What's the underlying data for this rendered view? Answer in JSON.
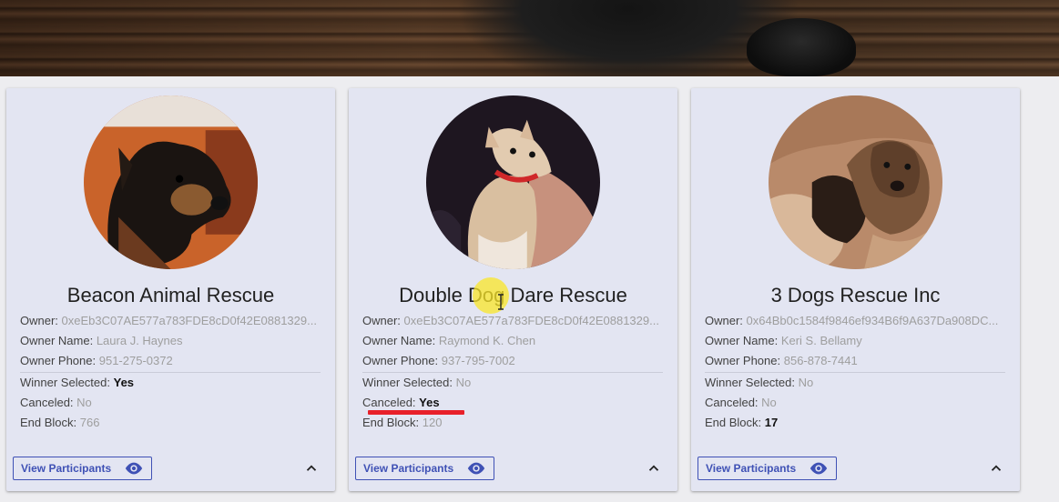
{
  "cards": [
    {
      "name": "Beacon Animal Rescue",
      "owner_label": "Owner:",
      "owner": "0xeEb3C07AE577a783FDE8cD0f42E0881329...",
      "owner_name_label": "Owner Name:",
      "owner_name": "Laura J. Haynes",
      "owner_phone_label": "Owner Phone:",
      "owner_phone": "951-275-0372",
      "winner_label": "Winner Selected:",
      "winner": "Yes",
      "canceled_label": "Canceled:",
      "canceled": "No",
      "end_block_label": "End Block:",
      "end_block": "766",
      "button_label": "View Participants",
      "image": "dog-portrait-black-tan"
    },
    {
      "name": "Double Dog Dare Rescue",
      "owner_label": "Owner:",
      "owner": "0xeEb3C07AE577a783FDE8cD0f42E0881329...",
      "owner_name_label": "Owner Name:",
      "owner_name": "Raymond K. Chen",
      "owner_phone_label": "Owner Phone:",
      "owner_phone": "937-795-7002",
      "winner_label": "Winner Selected:",
      "winner": "No",
      "canceled_label": "Canceled:",
      "canceled": "Yes",
      "end_block_label": "End Block:",
      "end_block": "120",
      "button_label": "View Participants",
      "image": "chihuahua-red-collar"
    },
    {
      "name": "3 Dogs Rescue Inc",
      "owner_label": "Owner:",
      "owner": "0x64Bb0c1584f9846ef934B6f9A637Da908DC...",
      "owner_name_label": "Owner Name:",
      "owner_name": "Keri S. Bellamy",
      "owner_phone_label": "Owner Phone:",
      "owner_phone": "856-878-7441",
      "winner_label": "Winner Selected:",
      "winner": "No",
      "canceled_label": "Canceled:",
      "canceled": "No",
      "end_block_label": "End Block:",
      "end_block": "17",
      "button_label": "View Participants",
      "image": "brindle-dog-with-puppies"
    }
  ],
  "icons": {
    "view": "eye-icon",
    "collapse": "chevron-up-icon"
  },
  "colors": {
    "accent": "#3f51b5",
    "card_bg": "#e3e5f2",
    "annotation": "#e8202a",
    "cursor_highlight": "#f5e02a"
  }
}
